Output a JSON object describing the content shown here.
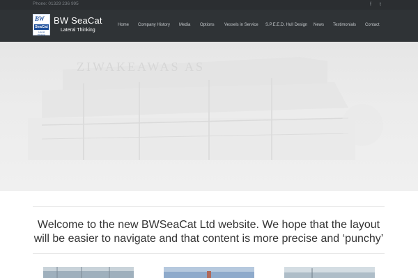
{
  "topbar": {
    "phone": "Phone: 01329 236 995",
    "social": [
      {
        "icon": "facebook-icon",
        "glyph": "f"
      },
      {
        "icon": "twitter-icon",
        "glyph": "t"
      }
    ]
  },
  "brand": {
    "logo_text_top": "BW",
    "logo_text_mid": "SeaCat",
    "logo_text_bottom": "Lateral Thinking",
    "name": "BW SeaCat",
    "tagline": "Lateral Thinking"
  },
  "nav": {
    "items": [
      {
        "label": "Home"
      },
      {
        "label": "Company History"
      },
      {
        "label": "Media"
      },
      {
        "label": "Options"
      },
      {
        "label": "Vessels in Service"
      },
      {
        "label": "S.P.E.E.D. Hull Design"
      },
      {
        "label": "News"
      },
      {
        "label": "Testimonials"
      },
      {
        "label": "Contact"
      }
    ]
  },
  "hero": {
    "faded_text": "ZIWAKEAWAS AS"
  },
  "welcome": {
    "text": "Welcome to the new BWSeaCat Ltd website. We hope that the layout will be easier to navigate and that content is more precise and ‘punchy’"
  },
  "colors": {
    "topbar_bg": "#2b2e31",
    "header_bg": "#2f3336",
    "nav_text": "#c7cbce",
    "logo_blue": "#1d4f9c"
  }
}
